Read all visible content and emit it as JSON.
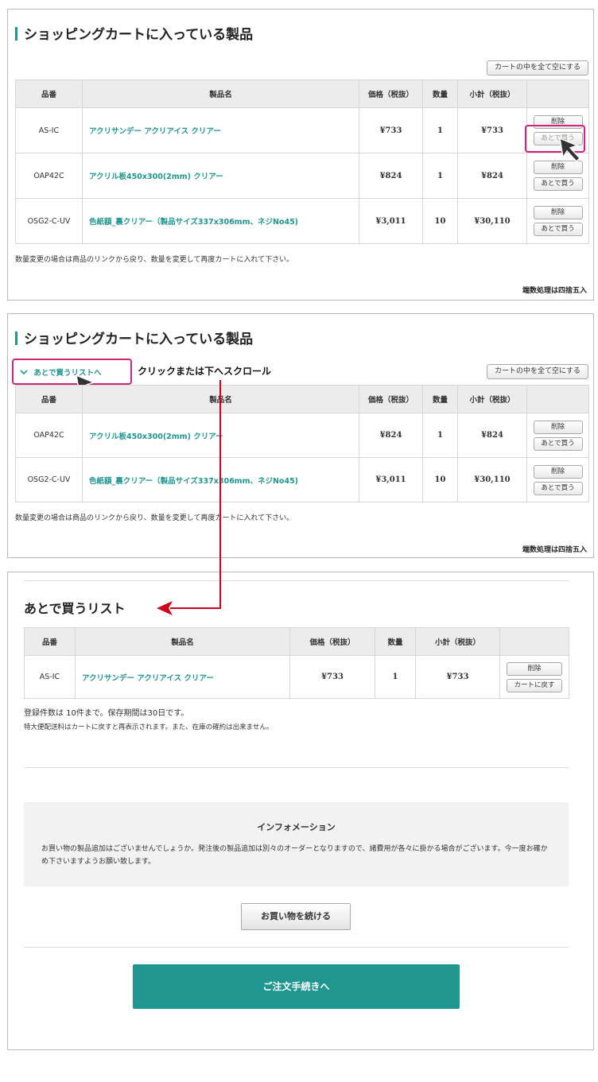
{
  "cart_title": "ショッピングカートに入っている製品",
  "empty_cart_label": "カートの中を全て空にする",
  "table_headers": [
    "品番",
    "製品名",
    "価格（税抜）",
    "数量",
    "小計（税抜）"
  ],
  "cart_rows_step1": [
    {
      "code": "AS-IC",
      "name": "アクリサンデー アクリアイス クリアー",
      "price": "¥733",
      "qty": "1",
      "subtotal": "¥733"
    },
    {
      "code": "OAP42C",
      "name": "アクリル板450x300(2mm) クリアー",
      "price": "¥824",
      "qty": "1",
      "subtotal": "¥824"
    },
    {
      "code": "OSG2-C-UV",
      "name": "色紙額_裏クリアー（製品サイズ337x306mm、ネジNo45)",
      "price": "¥3,011",
      "qty": "10",
      "subtotal": "¥30,110"
    }
  ],
  "cart_rows_step2": [
    {
      "code": "OAP42C",
      "name": "アクリル板450x300(2mm) クリアー",
      "price": "¥824",
      "qty": "1",
      "subtotal": "¥824"
    },
    {
      "code": "OSG2-C-UV",
      "name": "色紙額_裏クリアー（製品サイズ337x306mm、ネジNo45)",
      "price": "¥3,011",
      "qty": "10",
      "subtotal": "¥30,110"
    }
  ],
  "delete_label": "削除",
  "buy_later_label": "あとで買う",
  "qty_note": "数量変更の場合は商品のリンクから戻り、数量を変更して再度カートに入れて下さい。",
  "rounding_note": "端数処理は四捨五入",
  "later_toggle_label": "あとで買うリストへ",
  "toggle_chevron": "chevron-down-icon",
  "annotation_text": "クリックまたは下へスクロール",
  "later_list_title": "あとで買うリスト",
  "later_rows": [
    {
      "code": "AS-IC",
      "name": "アクリサンデー アクリアイス クリアー",
      "price": "¥733",
      "qty": "1",
      "subtotal": "¥733"
    }
  ],
  "return_to_cart_label": "カートに戻す",
  "registration_note": "登録件数は 10件まで。保存期間は30日です。",
  "oversize_note": "特大便配送料はカートに戻すと再表示されます。また、在庫の確約は出来ません。",
  "info_title": "インフォメーション",
  "info_body": "お買い物の製品追加はございませんでしょうか。発注後の製品追加は別々のオーダーとなりますので、諸費用が各々に掛かる場合がございます。今一度お確かめ下さいますようお願い致します。",
  "continue_label": "お買い物を続ける",
  "checkout_label": "ご注文手続きへ",
  "colors": {
    "accent": "#1f9690",
    "highlight": "#d0247f",
    "arrow": "#d0021b"
  }
}
